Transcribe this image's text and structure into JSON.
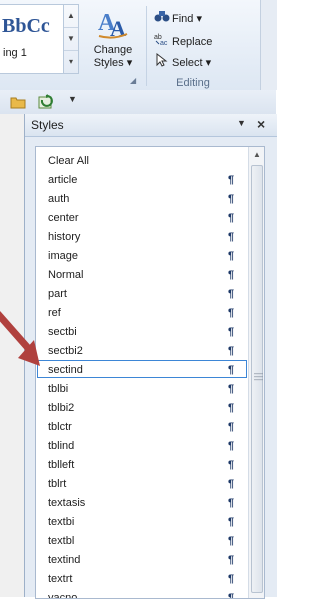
{
  "ribbon": {
    "style_gallery": {
      "preview_text": "BbCс",
      "style_name": "ing 1"
    },
    "change_styles": {
      "label_line1": "Change",
      "label_line2": "Styles ▾"
    },
    "editing": {
      "find_label": "Find ▾",
      "replace_label": "Replace",
      "select_label": "Select ▾",
      "group_label": "Editing"
    }
  },
  "styles_pane": {
    "title": "Styles",
    "menu_glyph": "▼",
    "close_glyph": "×",
    "paragraph_mark": "¶",
    "items": [
      {
        "label": "Clear All",
        "mark": ""
      },
      {
        "label": "article",
        "mark": "¶"
      },
      {
        "label": "auth",
        "mark": "¶"
      },
      {
        "label": "center",
        "mark": "¶"
      },
      {
        "label": "history",
        "mark": "¶"
      },
      {
        "label": "image",
        "mark": "¶"
      },
      {
        "label": "Normal",
        "mark": "¶"
      },
      {
        "label": "part",
        "mark": "¶"
      },
      {
        "label": "ref",
        "mark": "¶"
      },
      {
        "label": "sectbi",
        "mark": "¶"
      },
      {
        "label": "sectbi2",
        "mark": "¶"
      },
      {
        "label": "sectind",
        "mark": "¶"
      },
      {
        "label": "tblbi",
        "mark": "¶"
      },
      {
        "label": "tblbi2",
        "mark": "¶"
      },
      {
        "label": "tblctr",
        "mark": "¶"
      },
      {
        "label": "tblind",
        "mark": "¶"
      },
      {
        "label": "tblleft",
        "mark": "¶"
      },
      {
        "label": "tblrt",
        "mark": "¶"
      },
      {
        "label": "textasis",
        "mark": "¶"
      },
      {
        "label": "textbi",
        "mark": "¶"
      },
      {
        "label": "textbl",
        "mark": "¶"
      },
      {
        "label": "textind",
        "mark": "¶"
      },
      {
        "label": "textrt",
        "mark": "¶"
      },
      {
        "label": "yacno",
        "mark": "¶"
      }
    ],
    "selected_item": "sectind"
  },
  "colors": {
    "accent": "#3d86d6",
    "arrow": "#b0413e",
    "paragraph_mark": "#1f3a68"
  }
}
